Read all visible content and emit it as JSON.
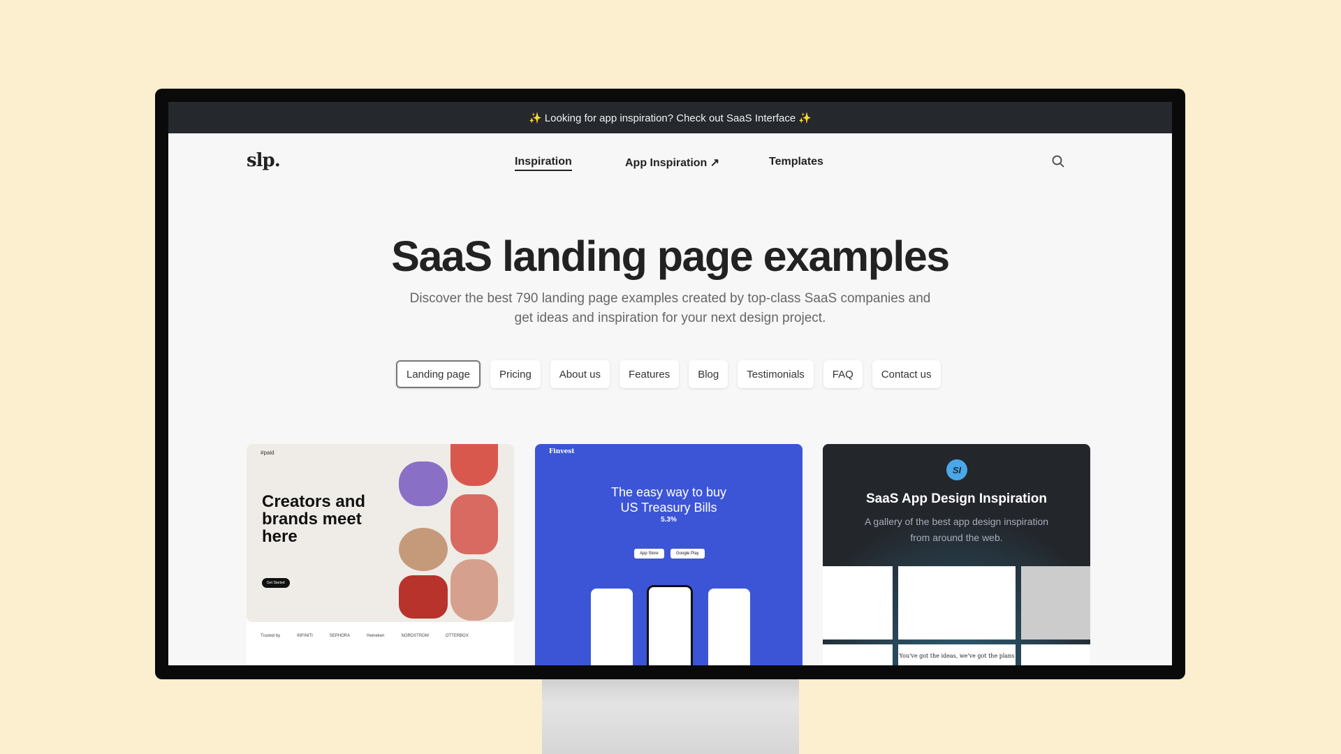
{
  "banner": {
    "text": "✨ Looking for app inspiration? Check out SaaS Interface ✨"
  },
  "nav": {
    "logo": "slp.",
    "links": [
      {
        "label": "Inspiration"
      },
      {
        "label": "App Inspiration ↗"
      },
      {
        "label": "Templates"
      }
    ],
    "search_icon": "search-icon"
  },
  "hero": {
    "title": "SaaS landing page examples",
    "subtitle_line1": "Discover the best 790 landing page examples created by top-class SaaS companies and",
    "subtitle_line2": "get ideas and inspiration for your next design project."
  },
  "filters": [
    {
      "label": "Landing page",
      "active": true
    },
    {
      "label": "Pricing"
    },
    {
      "label": "About us"
    },
    {
      "label": "Features"
    },
    {
      "label": "Blog"
    },
    {
      "label": "Testimonials"
    },
    {
      "label": "FAQ"
    },
    {
      "label": "Contact us"
    }
  ],
  "cards": [
    {
      "brand": "#paid",
      "headline": "Creators and brands meet here",
      "cta": "Get Started",
      "trusted": "Trusted by",
      "logos": [
        "INFINITI",
        "SEPHORA",
        "Heineken",
        "NORDSTROM",
        "OTTERBOX"
      ]
    },
    {
      "brand": "Finvest",
      "headline_line1": "The easy way to buy",
      "headline_line2": "US Treasury Bills",
      "rate": "5.3%",
      "app_store": "App Store",
      "google_play": "Google Play"
    },
    {
      "logo": "SI",
      "title": "SaaS App Design Inspiration",
      "subtitle_line1": "A gallery of the best app design inspiration",
      "subtitle_line2": "from around the web.",
      "thumb_text": "You've got the ideas, we've got the plans"
    }
  ]
}
